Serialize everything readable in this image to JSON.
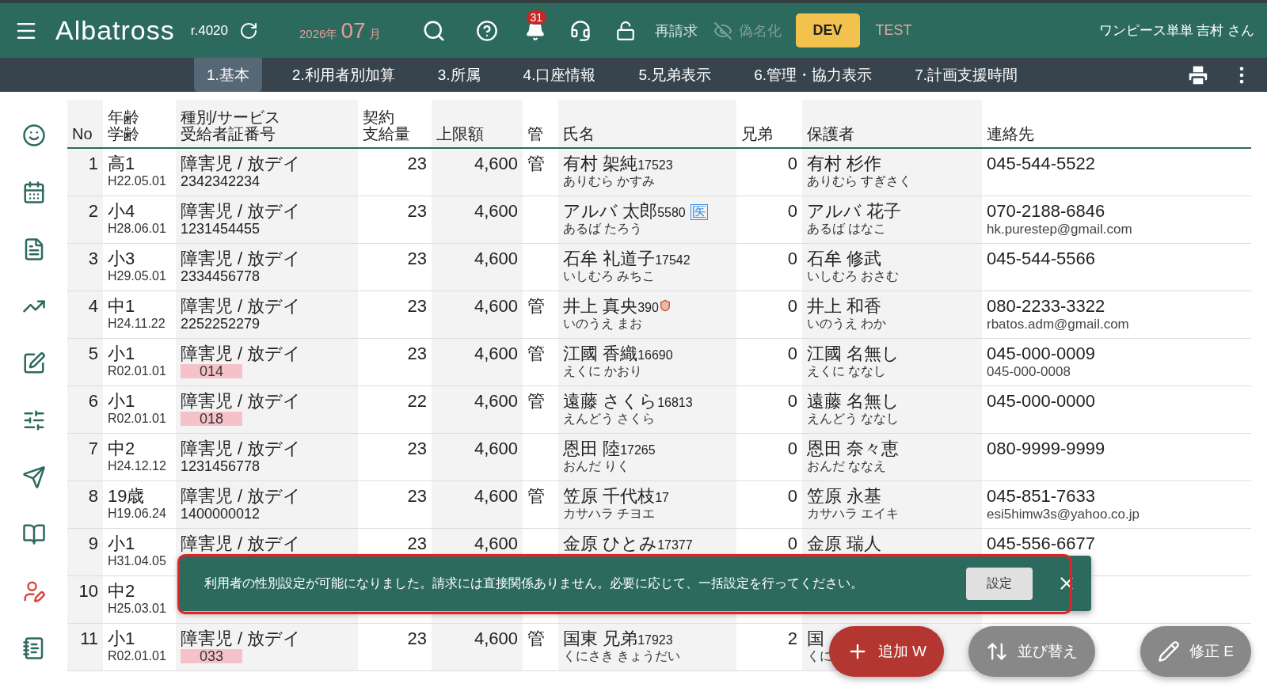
{
  "header": {
    "app_name": "Albatross",
    "revision": "r.4020",
    "year": "2026年",
    "month": "07",
    "month_unit": "月",
    "notification_count": "31",
    "actions": [
      {
        "label": "再請求",
        "disabled": false
      },
      {
        "label": "偽名化",
        "disabled": true
      }
    ],
    "environments": [
      {
        "label": "DEV",
        "selected": true
      },
      {
        "label": "TEST",
        "selected": false
      }
    ],
    "user": "ワンピース単単 吉村 さん"
  },
  "tabs": [
    {
      "label": "1.基本",
      "selected": true
    },
    {
      "label": "2.利用者別加算",
      "selected": false
    },
    {
      "label": "3.所属",
      "selected": false
    },
    {
      "label": "4.口座情報",
      "selected": false
    },
    {
      "label": "5.兄弟表示",
      "selected": false
    },
    {
      "label": "6.管理・協力表示",
      "selected": false
    },
    {
      "label": "7.計画支援時間",
      "selected": false
    }
  ],
  "sidebar": {
    "items": [
      {
        "selected": false
      },
      {
        "selected": false
      },
      {
        "selected": false
      },
      {
        "selected": false
      },
      {
        "selected": false
      },
      {
        "selected": false
      },
      {
        "selected": false
      },
      {
        "selected": false
      },
      {
        "selected": true
      },
      {
        "selected": false
      }
    ]
  },
  "table": {
    "columns": [
      {
        "lines": [
          "No"
        ]
      },
      {
        "lines": [
          "年齢",
          "学齢"
        ]
      },
      {
        "lines": [
          "種別/サービス",
          "受給者証番号"
        ]
      },
      {
        "lines": [
          "契約",
          "支給量"
        ]
      },
      {
        "lines": [
          "上限額"
        ]
      },
      {
        "lines": [
          "管"
        ]
      },
      {
        "lines": [
          "氏名"
        ]
      },
      {
        "lines": [
          "兄弟"
        ]
      },
      {
        "lines": [
          "保護者"
        ]
      },
      {
        "lines": [
          "連絡先"
        ]
      }
    ],
    "rows": [
      {
        "no": "1",
        "grade": "高1",
        "birth": "H22.05.01",
        "service": "障害児 / 放デイ",
        "cert": "2342342234",
        "cert_flagged": false,
        "contract": "23",
        "limit": "4,600",
        "kan": "管",
        "name": "有村 架純",
        "user_id": "17523",
        "reading": "ありむら かすみ",
        "shield": false,
        "siblings": "0",
        "guardian": "有村 杉作",
        "guardian_reading": "ありむら すぎさく",
        "contacts": [
          "045-544-5522"
        ]
      },
      {
        "no": "2",
        "grade": "小4",
        "birth": "H28.06.01",
        "service": "障害児 / 放デイ",
        "cert": "1231454455",
        "cert_flagged": false,
        "contract": "23",
        "limit": "4,600",
        "name": "アルバ 太郎",
        "user_id": "5580",
        "badge": "医",
        "reading": "あるば たろう",
        "shield": false,
        "siblings": "0",
        "guardian": "アルバ 花子",
        "guardian_reading": "あるば はなこ",
        "contacts": [
          "070-2188-6846",
          "hk.purestep@gmail.com"
        ]
      },
      {
        "no": "3",
        "grade": "小3",
        "birth": "H29.05.01",
        "service": "障害児 / 放デイ",
        "cert": "2334456778",
        "cert_flagged": false,
        "contract": "23",
        "limit": "4,600",
        "name": "石牟 礼道子",
        "user_id": "17542",
        "reading": "いしむろ みちこ",
        "shield": false,
        "siblings": "0",
        "guardian": "石牟 修武",
        "guardian_reading": "いしむろ おさむ",
        "contacts": [
          "045-544-5566"
        ]
      },
      {
        "no": "4",
        "grade": "中1",
        "birth": "H24.11.22",
        "service": "障害児 / 放デイ",
        "cert": "2252252279",
        "cert_flagged": false,
        "contract": "23",
        "limit": "4,600",
        "kan": "管",
        "name": "井上 真央",
        "user_id": "390",
        "reading": "いのうえ まお",
        "shield": true,
        "siblings": "0",
        "guardian": "井上 和香",
        "guardian_reading": "いのうえ わか",
        "contacts": [
          "080-2233-3322",
          "rbatos.adm@gmail.com"
        ]
      },
      {
        "no": "5",
        "grade": "小1",
        "birth": "R02.01.01",
        "service": "障害児 / 放デイ",
        "cert": "014",
        "cert_flagged": true,
        "contract": "23",
        "limit": "4,600",
        "kan": "管",
        "name": "江國 香織",
        "user_id": "16690",
        "reading": "えくに かおり",
        "shield": false,
        "siblings": "0",
        "guardian": "江國 名無し",
        "guardian_reading": "えくに ななし",
        "contacts": [
          "045-000-0009",
          "045-000-0008"
        ]
      },
      {
        "no": "6",
        "grade": "小1",
        "birth": "R02.01.01",
        "service": "障害児 / 放デイ",
        "cert": "018",
        "cert_flagged": true,
        "contract": "22",
        "limit": "4,600",
        "kan": "管",
        "name": "遠藤 さくら",
        "user_id": "16813",
        "reading": "えんどう さくら",
        "shield": false,
        "siblings": "0",
        "guardian": "遠藤 名無し",
        "guardian_reading": "えんどう ななし",
        "contacts": [
          "045-000-0000"
        ]
      },
      {
        "no": "7",
        "grade": "中2",
        "birth": "H24.12.12",
        "service": "障害児 / 放デイ",
        "cert": "1231456778",
        "cert_flagged": false,
        "contract": "23",
        "limit": "4,600",
        "name": "恩田 陸",
        "user_id": "17265",
        "reading": "おんだ りく",
        "shield": false,
        "siblings": "0",
        "guardian": "恩田 奈々恵",
        "guardian_reading": "おんだ ななえ",
        "contacts": [
          "080-9999-9999"
        ]
      },
      {
        "no": "8",
        "grade": "19歳",
        "birth": "H19.06.24",
        "service": "障害児 / 放デイ",
        "cert": "1400000012",
        "cert_flagged": false,
        "contract": "23",
        "limit": "4,600",
        "kan": "管",
        "name": "笠原 千代枝",
        "user_id": "17",
        "reading": "カサハラ チヨエ",
        "shield": false,
        "siblings": "0",
        "guardian": "笠原 永基",
        "guardian_reading": "カサハラ エイキ",
        "contacts": [
          "045-851-7633",
          "esi5himw3s@yahoo.co.jp"
        ]
      },
      {
        "no": "9",
        "grade": "小1",
        "birth": "H31.04.05",
        "service": "障害児 / 放デイ",
        "contract": "23",
        "limit": "4,600",
        "name": "金原 ひとみ",
        "user_id": "17377",
        "shield": false,
        "siblings": "0",
        "guardian": "金原 瑞人",
        "contacts": [
          "045-556-6677"
        ]
      },
      {
        "no": "10",
        "grade": "中2",
        "birth": "H25.03.01",
        "shield": false
      },
      {
        "no": "11",
        "grade": "小1",
        "birth": "R02.01.01",
        "service": "障害児 / 放デイ",
        "cert": "033",
        "cert_flagged": true,
        "contract": "23",
        "limit": "4,600",
        "kan": "管",
        "name": "国東 兄弟",
        "user_id": "17923",
        "reading": "くにさき きょうだい",
        "shield": false,
        "siblings": "2",
        "guardian": "国",
        "guardian_reading": "くに"
      }
    ]
  },
  "snackbar": {
    "message": "利用者の性別設定が可能になりました。請求には直接関係ありません。必要に応じて、一括設定を行ってください。",
    "action": "設定"
  },
  "fab_buttons": [
    {
      "label": "追加 W",
      "kind": "primary"
    },
    {
      "label": "並び替え",
      "kind": "secondary"
    },
    {
      "label": "修正 E",
      "kind": "secondary"
    }
  ]
}
